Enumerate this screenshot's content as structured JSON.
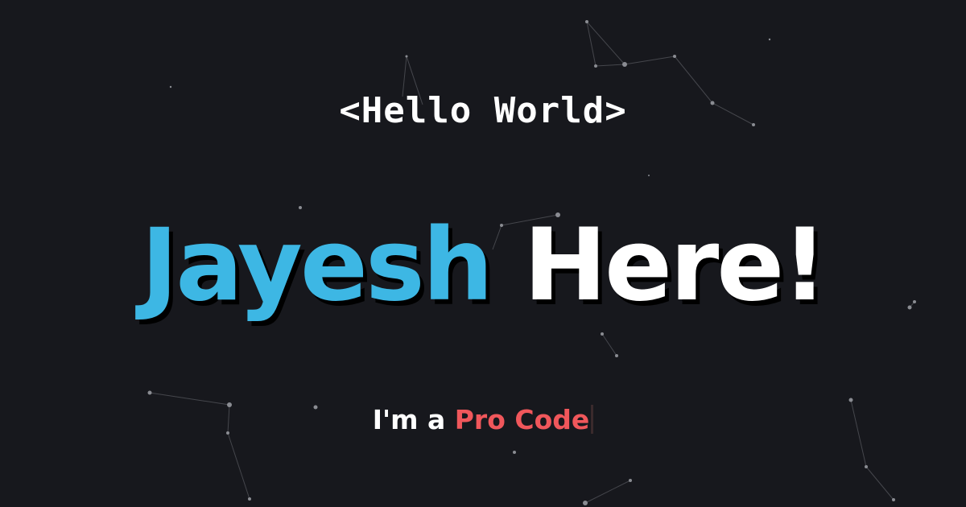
{
  "hero": {
    "greeting": "<Hello World>",
    "name": "Jayesh",
    "exclaim": "Here!",
    "tagline_prefix": "I'm a",
    "tagline_role": "Pro Code"
  },
  "colors": {
    "background": "#17181d",
    "name": "#3db7e4",
    "role": "#f0575b",
    "text": "#ffffff"
  }
}
